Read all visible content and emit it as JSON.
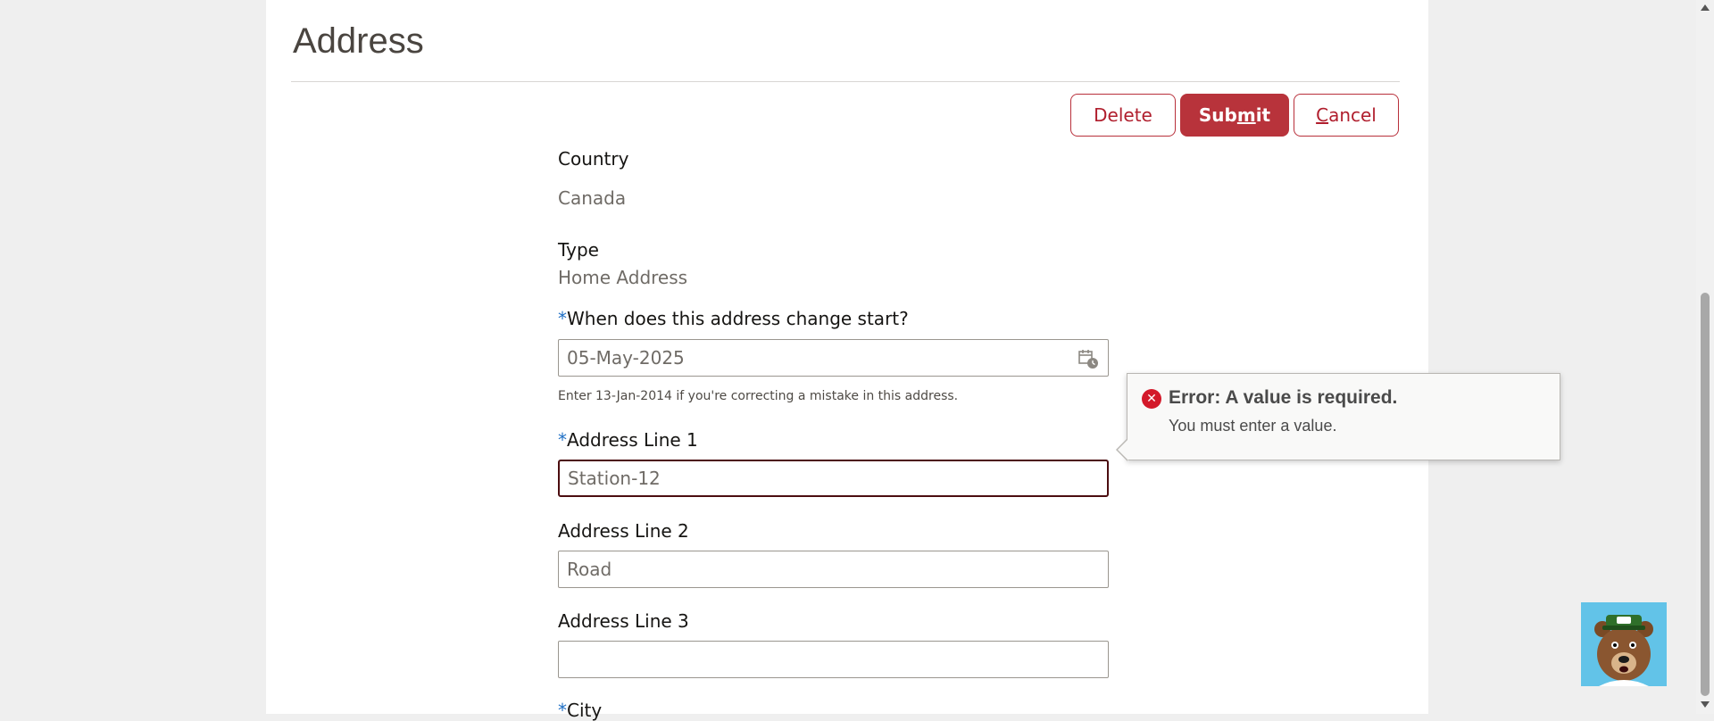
{
  "page": {
    "title": "Address"
  },
  "actions": {
    "delete_label": "Delete",
    "submit_pre": "Sub",
    "submit_mnemonic": "m",
    "submit_post": "it",
    "cancel_mnemonic": "C",
    "cancel_post": "ancel"
  },
  "form": {
    "country": {
      "label": "Country",
      "value": "Canada"
    },
    "type": {
      "label": "Type",
      "value": "Home Address"
    },
    "start_date": {
      "required_mark": "*",
      "label": "When does this address change start?",
      "value": "05-May-2025",
      "help": "Enter 13-Jan-2014 if you're correcting a mistake in this address."
    },
    "address_line_1": {
      "required_mark": "*",
      "label": "Address Line 1",
      "value": "Station-12"
    },
    "address_line_2": {
      "label": "Address Line 2",
      "value": "Road"
    },
    "address_line_3": {
      "label": "Address Line 3",
      "value": ""
    },
    "city": {
      "required_mark": "*",
      "label": "City"
    }
  },
  "error_popup": {
    "icon": "error-x-icon",
    "title": "Error: A value is required.",
    "message": "You must enter a value."
  },
  "colors": {
    "brand_red": "#b8333b",
    "error_red": "#d3192a",
    "required_blue": "#1f6fc5",
    "mascot_bg": "#62c3e8"
  }
}
